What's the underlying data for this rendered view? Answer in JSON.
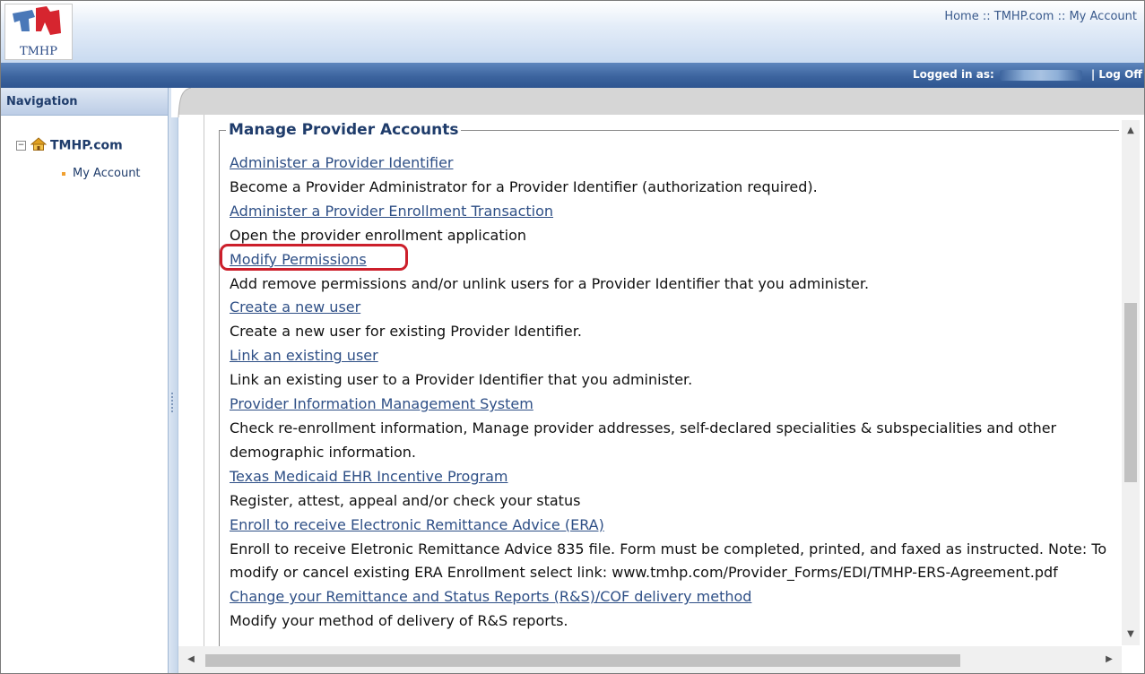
{
  "header": {
    "logo_text": "TMHP",
    "links": {
      "home": "Home",
      "tmhp": "TMHP.com",
      "account": "My Account",
      "separator": "::"
    }
  },
  "bar": {
    "logged_in_label": "Logged in as:",
    "logoff_sep": "|",
    "logoff": "Log Off"
  },
  "nav": {
    "title": "Navigation",
    "tree": {
      "root": "TMHP.com",
      "children": [
        "My Account"
      ]
    }
  },
  "main": {
    "section_title": "Manage Provider Accounts",
    "items": [
      {
        "link": "Administer a Provider Identifier",
        "desc": "Become a Provider Administrator for a Provider Identifier (authorization required)."
      },
      {
        "link": "Administer a Provider Enrollment Transaction",
        "desc": "Open the provider enrollment application"
      },
      {
        "link": "Modify Permissions",
        "desc": "Add remove permissions and/or unlink users for a Provider Identifier that you administer."
      },
      {
        "link": "Create a new user",
        "desc": "Create a new user for existing Provider Identifier."
      },
      {
        "link": "Link an existing user",
        "desc": "Link an existing user to a Provider Identifier that you administer."
      },
      {
        "link": "Provider Information Management System",
        "desc": "Check re-enrollment information, Manage provider addresses, self-declared specialities & subspecialities and other demographic information."
      },
      {
        "link": "Texas Medicaid EHR Incentive Program",
        "desc": "Register, attest, appeal and/or check your status"
      },
      {
        "link": "Enroll to receive Electronic Remittance Advice (ERA)",
        "desc": "Enroll to receive Eletronic Remittance Advice 835 file. Form must be completed, printed, and faxed as instructed. Note: To modify or cancel existing ERA Enrollment select link: www.tmhp.com/Provider_Forms/EDI/TMHP-ERS-Agreement.pdf"
      },
      {
        "link": "Change your Remittance and Status Reports (R&S)/COF delivery method",
        "desc": "Modify your method of delivery of R&S reports."
      }
    ],
    "highlighted_item": "Modify Permissions"
  },
  "colors": {
    "accent_blue": "#3c649e",
    "link": "#2e4f86",
    "highlight": "#cc1f2b"
  },
  "icons": [
    "tmhp-logo",
    "collapse-icon",
    "home-icon",
    "scroll-up-icon",
    "scroll-down-icon",
    "scroll-left-icon",
    "scroll-right-icon"
  ]
}
